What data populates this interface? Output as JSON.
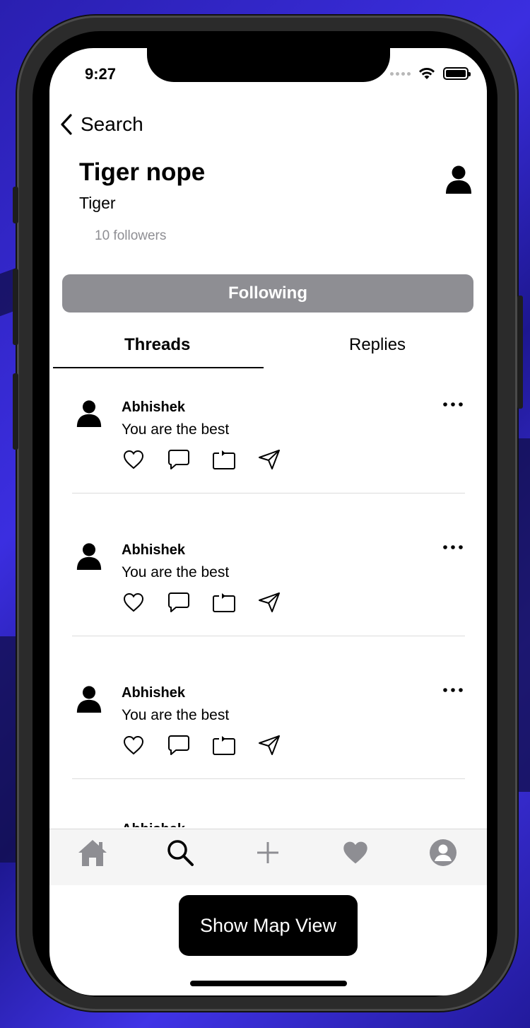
{
  "status_bar": {
    "time": "9:27"
  },
  "nav": {
    "back_label": "Search"
  },
  "profile": {
    "name": "Tiger nope",
    "handle": "Tiger",
    "followers": "10 followers",
    "follow_button": "Following"
  },
  "tabs": [
    {
      "label": "Threads",
      "selected": true
    },
    {
      "label": "Replies",
      "selected": false
    }
  ],
  "threads": [
    {
      "author": "Abhishek",
      "text": "You are the best"
    },
    {
      "author": "Abhishek",
      "text": "You are the best"
    },
    {
      "author": "Abhishek",
      "text": "You are the best"
    }
  ],
  "thread_peek": {
    "author": "Abhishek"
  },
  "tab_bar": {
    "items": [
      {
        "icon": "home-icon"
      },
      {
        "icon": "search-icon"
      },
      {
        "icon": "plus-icon"
      },
      {
        "icon": "heart-icon"
      },
      {
        "icon": "profile-icon"
      }
    ]
  },
  "map_button": {
    "label": "Show Map View"
  },
  "colors": {
    "following_button": "#8e8e93",
    "followers_text": "#8e8e93",
    "tab_bar_bg": "#f5f5f5",
    "map_button_bg": "#000000"
  }
}
